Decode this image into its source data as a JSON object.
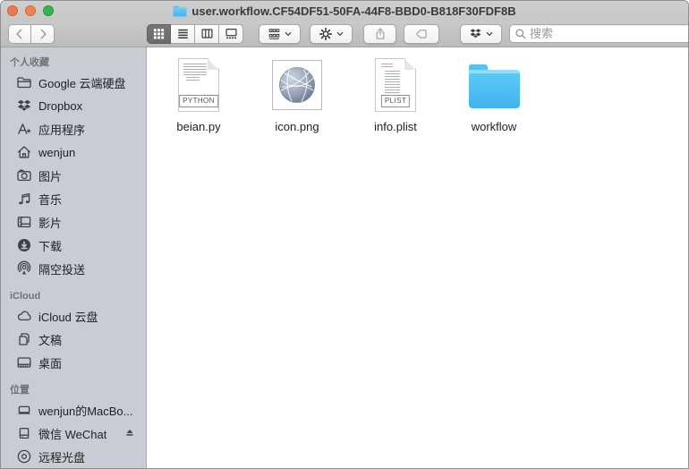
{
  "window": {
    "title": "user.workflow.CF54DF51-50FA-44F8-BBD0-B818F30FDF8B",
    "proxy_icon": "folder-icon",
    "traffic_lights": [
      "close",
      "minimize",
      "zoom"
    ]
  },
  "toolbar": {
    "back_icon": "chevron-left-icon",
    "forward_icon": "chevron-right-icon",
    "view_modes": [
      "icon-view",
      "list-view",
      "column-view",
      "gallery-view"
    ],
    "selected_view": "icon-view",
    "group_icon": "group-by-icon",
    "action_icon": "gear-icon",
    "share_icon": "share-icon",
    "tag_icon": "tag-icon",
    "dropbox_icon": "dropbox-icon",
    "search_icon": "magnifier-icon",
    "search_placeholder": "搜索"
  },
  "sidebar": {
    "sections": [
      {
        "label": "个人收藏",
        "items": [
          {
            "label": "Google 云端硬盘",
            "icon": "folder-icon"
          },
          {
            "label": "Dropbox",
            "icon": "dropbox-icon"
          },
          {
            "label": "应用程序",
            "icon": "applications-icon"
          },
          {
            "label": "wenjun",
            "icon": "home-icon"
          },
          {
            "label": "图片",
            "icon": "camera-icon"
          },
          {
            "label": "音乐",
            "icon": "music-note-icon"
          },
          {
            "label": "影片",
            "icon": "film-icon"
          },
          {
            "label": "下载",
            "icon": "download-circle-icon"
          },
          {
            "label": "隔空投送",
            "icon": "airdrop-icon"
          }
        ]
      },
      {
        "label": "iCloud",
        "items": [
          {
            "label": "iCloud 云盘",
            "icon": "cloud-icon"
          },
          {
            "label": "文稿",
            "icon": "documents-icon"
          },
          {
            "label": "桌面",
            "icon": "desktop-icon"
          }
        ]
      },
      {
        "label": "位置",
        "items": [
          {
            "label": "wenjun的MacBo...",
            "icon": "laptop-icon"
          },
          {
            "label": "微信 WeChat",
            "icon": "external-disk-icon",
            "eject": true
          },
          {
            "label": "远程光盘",
            "icon": "optical-disc-icon"
          }
        ]
      }
    ]
  },
  "files": [
    {
      "name": "beian.py",
      "kind": "python-script",
      "badge": "PYTHON"
    },
    {
      "name": "icon.png",
      "kind": "png-image"
    },
    {
      "name": "info.plist",
      "kind": "property-list",
      "badge": "PLIST"
    },
    {
      "name": "workflow",
      "kind": "folder"
    }
  ],
  "colors": {
    "folder_blue": "#4db9ef",
    "traffic_close": "#f1764d",
    "traffic_minimize": "#f1824d",
    "traffic_zoom": "#30b64a",
    "sidebar_bg": "#c9cdd3",
    "selected_segment": "#6d6d6d"
  }
}
